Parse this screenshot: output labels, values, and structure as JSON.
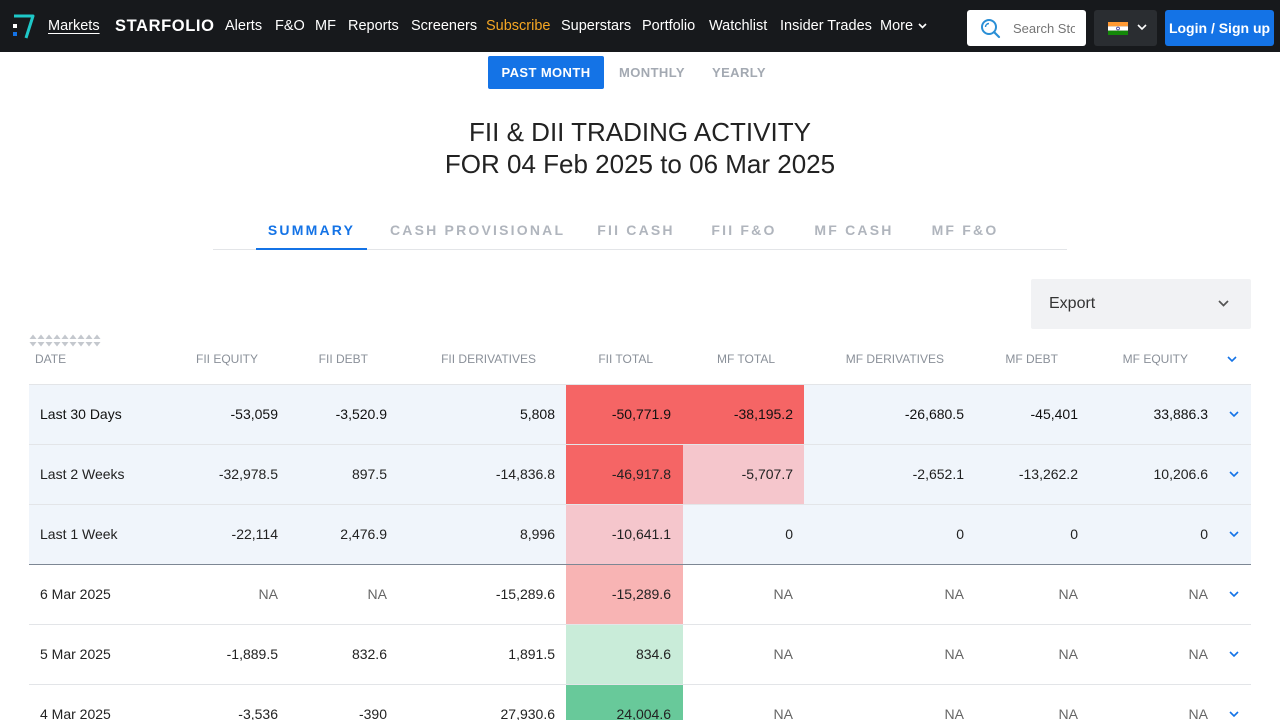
{
  "nav": {
    "items": [
      {
        "label": "Markets"
      },
      {
        "label": "STARFOLIO"
      },
      {
        "label": "Alerts"
      },
      {
        "label": "F&O"
      },
      {
        "label": "MF"
      },
      {
        "label": "Reports"
      },
      {
        "label": "Screeners"
      },
      {
        "label": "Subscribe"
      },
      {
        "label": "Superstars"
      },
      {
        "label": "Portfolio"
      },
      {
        "label": "Watchlist"
      },
      {
        "label": "Insider Trades"
      },
      {
        "label": "More"
      }
    ],
    "search_placeholder": "Search Stocks",
    "login_label": "Login / Sign up",
    "subscribe_color": "#f5a623",
    "accent": "#1473e6"
  },
  "period": {
    "tabs": [
      "PAST MONTH",
      "MONTHLY",
      "YEARLY"
    ],
    "active": "PAST MONTH"
  },
  "heading": {
    "line1": "FII & DII TRADING ACTIVITY",
    "line2": "FOR 04 Feb 2025 to 06 Mar 2025"
  },
  "tabs": [
    "SUMMARY",
    "CASH PROVISIONAL",
    "FII CASH",
    "FII F&O",
    "MF CASH",
    "MF F&O"
  ],
  "active_tab": "SUMMARY",
  "export_label": "Export",
  "table": {
    "columns": [
      "DATE",
      "FII EQUITY",
      "FII DEBT",
      "FII DERIVATIVES",
      "FII TOTAL",
      "MF TOTAL",
      "MF DERIVATIVES",
      "MF DEBT",
      "MF EQUITY"
    ],
    "rows": [
      {
        "date": "Last 30 Days",
        "fii_equity": "-53,059",
        "fii_debt": "-3,520.9",
        "fii_derivatives": "5,808",
        "fii_total": "-50,771.9",
        "mf_total": "-38,195.2",
        "mf_derivatives": "-26,680.5",
        "mf_debt": "-45,401",
        "mf_equity": "33,886.3",
        "fii_total_color": "#f56565",
        "mf_total_color": "#f56565"
      },
      {
        "date": "Last 2 Weeks",
        "fii_equity": "-32,978.5",
        "fii_debt": "897.5",
        "fii_derivatives": "-14,836.8",
        "fii_total": "-46,917.8",
        "mf_total": "-5,707.7",
        "mf_derivatives": "-2,652.1",
        "mf_debt": "-13,262.2",
        "mf_equity": "10,206.6",
        "fii_total_color": "#f56565",
        "mf_total_color": "#f5c6cc"
      },
      {
        "date": "Last 1 Week",
        "fii_equity": "-22,114",
        "fii_debt": "2,476.9",
        "fii_derivatives": "8,996",
        "fii_total": "-10,641.1",
        "mf_total": "0",
        "mf_derivatives": "0",
        "mf_debt": "0",
        "mf_equity": "0",
        "fii_total_color": "#f5c6cc",
        "mf_total_color": ""
      },
      {
        "date": "6 Mar 2025",
        "fii_equity": "NA",
        "fii_debt": "NA",
        "fii_derivatives": "-15,289.6",
        "fii_total": "-15,289.6",
        "mf_total": "NA",
        "mf_derivatives": "NA",
        "mf_debt": "NA",
        "mf_equity": "NA",
        "fii_total_color": "#f8b4b4",
        "mf_total_color": ""
      },
      {
        "date": "5 Mar 2025",
        "fii_equity": "-1,889.5",
        "fii_debt": "832.6",
        "fii_derivatives": "1,891.5",
        "fii_total": "834.6",
        "mf_total": "NA",
        "mf_derivatives": "NA",
        "mf_debt": "NA",
        "mf_equity": "NA",
        "fii_total_color": "#c9ecd9",
        "mf_total_color": ""
      },
      {
        "date": "4 Mar 2025",
        "fii_equity": "-3,536",
        "fii_debt": "-390",
        "fii_derivatives": "27,930.6",
        "fii_total": "24,004.6",
        "mf_total": "NA",
        "mf_derivatives": "NA",
        "mf_debt": "NA",
        "mf_equity": "NA",
        "fii_total_color": "#68c99a",
        "mf_total_color": ""
      }
    ]
  }
}
